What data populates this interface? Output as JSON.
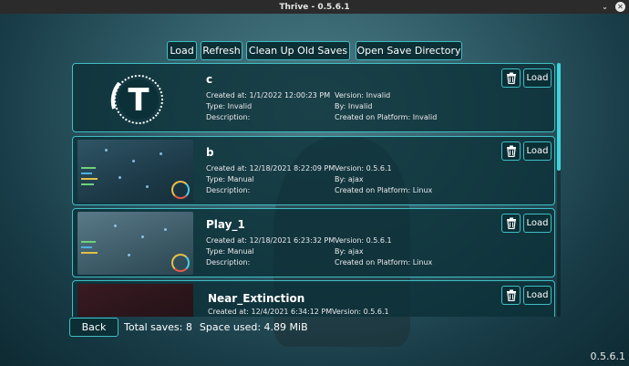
{
  "window": {
    "title": "Thrive - 0.5.6.1",
    "minimize_glyph": "⌄",
    "close_glyph": "✕"
  },
  "toolbar": {
    "load_label": "Load",
    "refresh_label": "Refresh",
    "cleanup_label": "Clean Up Old Saves",
    "open_dir_label": "Open Save Directory"
  },
  "saves": [
    {
      "name": "c",
      "created_at": "Created at: 1/1/2022 12:00:23 PM",
      "version": "Version: Invalid",
      "type": "Type: Invalid",
      "by": "By: Invalid",
      "description": "Description:",
      "platform": "Created on Platform: Invalid",
      "load_label": "Load",
      "delete_icon": "trash-icon"
    },
    {
      "name": "b",
      "created_at": "Created at: 12/18/2021 8:22:09 PM",
      "version": "Version: 0.5.6.1",
      "type": "Type: Manual",
      "by": "By: ajax",
      "description": "Description:",
      "platform": "Created on Platform: Linux",
      "load_label": "Load",
      "delete_icon": "trash-icon"
    },
    {
      "name": "Play_1",
      "created_at": "Created at: 12/18/2021 6:23:32 PM",
      "version": "Version: 0.5.6.1",
      "type": "Type: Manual",
      "by": "By: ajax",
      "description": "Description:",
      "platform": "Created on Platform: Linux",
      "load_label": "Load",
      "delete_icon": "trash-icon"
    },
    {
      "name": "Near_Extinction",
      "created_at": "Created at: 12/4/2021 6:34:12 PM",
      "version": "Version: 0.5.6.1",
      "load_label": "Load",
      "delete_icon": "trash-icon"
    }
  ],
  "logo_letter": "T",
  "footer": {
    "back_label": "Back",
    "total_saves": "Total saves: 8",
    "space_used": "Space used: 4.89 MiB"
  },
  "version_label": "0.5.6.1",
  "colors": {
    "accent": "#3fbfc4",
    "panel": "#0c3037",
    "scroll_thumb": "#3fd4dc"
  }
}
